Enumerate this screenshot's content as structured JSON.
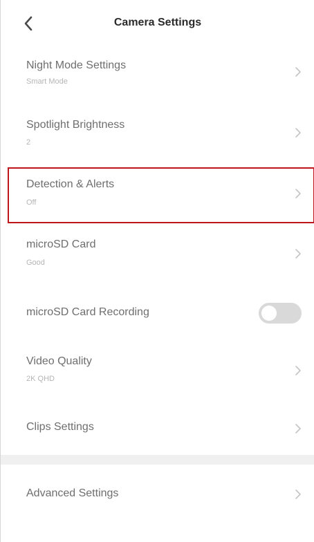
{
  "header": {
    "back_icon": "chevron-left-icon",
    "title": "Camera Settings"
  },
  "settings": {
    "night_mode": {
      "label": "Night Mode Settings",
      "value": "Smart Mode"
    },
    "spotlight": {
      "label": "Spotlight Brightness",
      "value": "2"
    },
    "detection": {
      "label": "Detection & Alerts",
      "value": "Off"
    },
    "microsd": {
      "label": "microSD Card",
      "value": "Good"
    },
    "recording": {
      "label": "microSD Card Recording",
      "enabled": false
    },
    "video_quality": {
      "label": "Video Quality",
      "value": "2K QHD"
    },
    "clips": {
      "label": "Clips Settings"
    },
    "advanced": {
      "label": "Advanced Settings"
    }
  },
  "colors": {
    "highlight": "#c0141c",
    "text": "#6e6e6e",
    "subtext": "#b5b5b5",
    "toggle_off": "#d9d9d9"
  }
}
